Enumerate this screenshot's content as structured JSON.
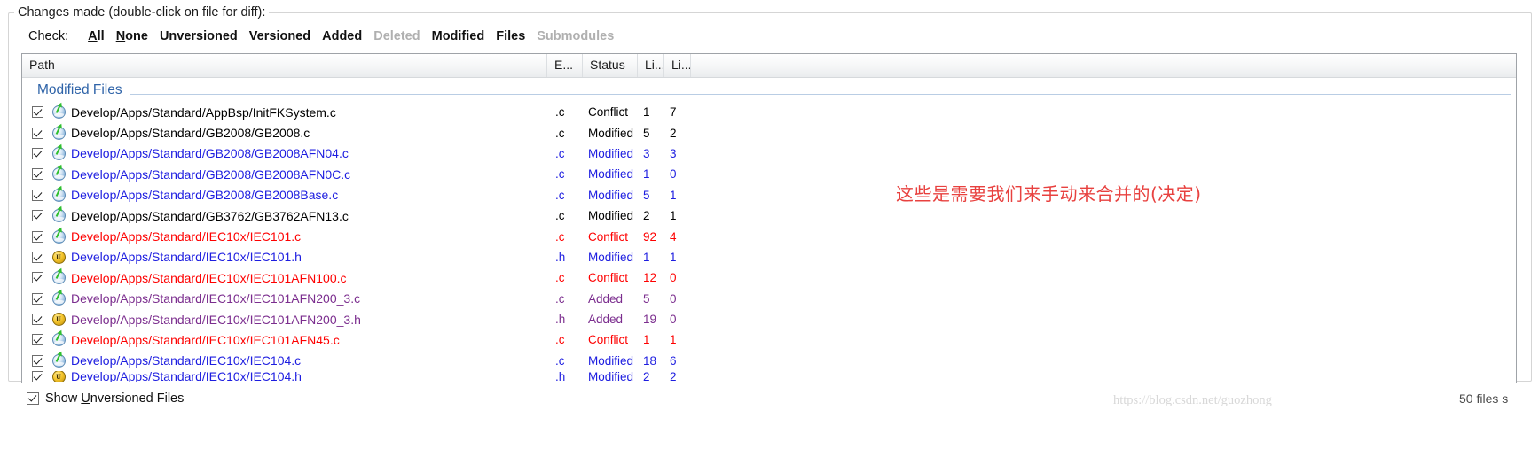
{
  "groupbox": {
    "title": "Changes made (double-click on file for diff):"
  },
  "check_row": {
    "label": "Check:",
    "links": [
      {
        "label": "All",
        "disabled": false
      },
      {
        "label": "None",
        "disabled": false
      },
      {
        "label": "Unversioned",
        "disabled": false
      },
      {
        "label": "Versioned",
        "disabled": false
      },
      {
        "label": "Added",
        "disabled": false
      },
      {
        "label": "Deleted",
        "disabled": true
      },
      {
        "label": "Modified",
        "disabled": false
      },
      {
        "label": "Files",
        "disabled": false
      },
      {
        "label": "Submodules",
        "disabled": true
      }
    ]
  },
  "table": {
    "columns": [
      "Path",
      "E...",
      "Status",
      "Li...",
      "Li..."
    ],
    "group_header": "Modified Files",
    "rows": [
      {
        "checked": true,
        "icon": "c-source-icon",
        "path": "Develop/Apps/Standard/AppBsp/InitFKSystem.c",
        "ext": ".c",
        "status": "Conflict",
        "lines_added": "1",
        "lines_removed": "7",
        "color": "black"
      },
      {
        "checked": true,
        "icon": "c-source-icon",
        "path": "Develop/Apps/Standard/GB2008/GB2008.c",
        "ext": ".c",
        "status": "Modified",
        "lines_added": "5",
        "lines_removed": "2",
        "color": "black"
      },
      {
        "checked": true,
        "icon": "c-source-icon",
        "path": "Develop/Apps/Standard/GB2008/GB2008AFN04.c",
        "ext": ".c",
        "status": "Modified",
        "lines_added": "3",
        "lines_removed": "3",
        "color": "blue"
      },
      {
        "checked": true,
        "icon": "c-source-icon",
        "path": "Develop/Apps/Standard/GB2008/GB2008AFN0C.c",
        "ext": ".c",
        "status": "Modified",
        "lines_added": "1",
        "lines_removed": "0",
        "color": "blue"
      },
      {
        "checked": true,
        "icon": "c-source-icon",
        "path": "Develop/Apps/Standard/GB2008/GB2008Base.c",
        "ext": ".c",
        "status": "Modified",
        "lines_added": "5",
        "lines_removed": "1",
        "color": "blue"
      },
      {
        "checked": true,
        "icon": "c-source-icon",
        "path": "Develop/Apps/Standard/GB3762/GB3762AFN13.c",
        "ext": ".c",
        "status": "Modified",
        "lines_added": "2",
        "lines_removed": "1",
        "color": "black"
      },
      {
        "checked": true,
        "icon": "c-source-icon",
        "path": "Develop/Apps/Standard/IEC10x/IEC101.c",
        "ext": ".c",
        "status": "Conflict",
        "lines_added": "92",
        "lines_removed": "4",
        "color": "red"
      },
      {
        "checked": true,
        "icon": "h-header-icon",
        "path": "Develop/Apps/Standard/IEC10x/IEC101.h",
        "ext": ".h",
        "status": "Modified",
        "lines_added": "1",
        "lines_removed": "1",
        "color": "blue"
      },
      {
        "checked": true,
        "icon": "c-source-icon",
        "path": "Develop/Apps/Standard/IEC10x/IEC101AFN100.c",
        "ext": ".c",
        "status": "Conflict",
        "lines_added": "12",
        "lines_removed": "0",
        "color": "red"
      },
      {
        "checked": true,
        "icon": "c-source-icon",
        "path": "Develop/Apps/Standard/IEC10x/IEC101AFN200_3.c",
        "ext": ".c",
        "status": "Added",
        "lines_added": "5",
        "lines_removed": "0",
        "color": "purple"
      },
      {
        "checked": true,
        "icon": "h-header-icon",
        "path": "Develop/Apps/Standard/IEC10x/IEC101AFN200_3.h",
        "ext": ".h",
        "status": "Added",
        "lines_added": "19",
        "lines_removed": "0",
        "color": "purple"
      },
      {
        "checked": true,
        "icon": "c-source-icon",
        "path": "Develop/Apps/Standard/IEC10x/IEC101AFN45.c",
        "ext": ".c",
        "status": "Conflict",
        "lines_added": "1",
        "lines_removed": "1",
        "color": "red"
      },
      {
        "checked": true,
        "icon": "c-source-icon",
        "path": "Develop/Apps/Standard/IEC10x/IEC104.c",
        "ext": ".c",
        "status": "Modified",
        "lines_added": "18",
        "lines_removed": "6",
        "color": "blue"
      },
      {
        "checked": true,
        "icon": "h-header-icon",
        "path": "Develop/Apps/Standard/IEC10x/IEC104.h",
        "ext": ".h",
        "status": "Modified",
        "lines_added": "2",
        "lines_removed": "2",
        "color": "blue"
      }
    ]
  },
  "icons": {
    "h_header_glyph": "U"
  },
  "bottom": {
    "show_unversioned_label": "Show Unversioned Files",
    "show_unversioned_checked": true,
    "watermark": "https://blog.csdn.net/guozhong",
    "file_count": "50 files s"
  },
  "annotation": {
    "text": "这些是需要我们来手动来合并的(决定)"
  },
  "colors": {
    "black": "#000000",
    "blue": "#1d1de0",
    "red": "#fe0000",
    "purple": "#7b2d8e",
    "group_header": "#2e63a8",
    "annotation": "#e8413f"
  }
}
